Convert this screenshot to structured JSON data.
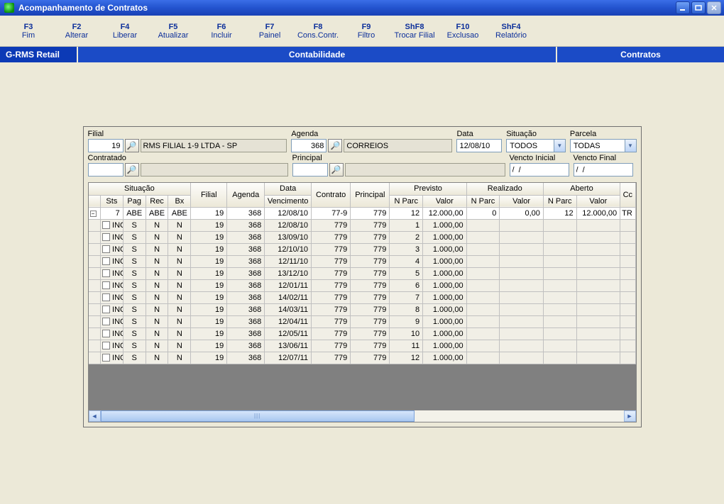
{
  "window": {
    "title": "Acompanhamento de Contratos"
  },
  "toolbar": [
    {
      "key": "F3",
      "label": "Fim"
    },
    {
      "key": "F2",
      "label": "Alterar"
    },
    {
      "key": "F4",
      "label": "Liberar"
    },
    {
      "key": "F5",
      "label": "Atualizar"
    },
    {
      "key": "F6",
      "label": "Incluir"
    },
    {
      "key": "F7",
      "label": "Painel"
    },
    {
      "key": "F8",
      "label": "Cons.Contr."
    },
    {
      "key": "F9",
      "label": "Filtro"
    },
    {
      "key": "ShF8",
      "label": "Trocar Filial"
    },
    {
      "key": "F10",
      "label": "Exclusao"
    },
    {
      "key": "ShF4",
      "label": "Relatório"
    }
  ],
  "ribbon": {
    "left": "G-RMS Retail",
    "mid": "Contabilidade",
    "right": "Contratos"
  },
  "filters": {
    "filial": {
      "label": "Filial",
      "value": "19",
      "display": "RMS FILIAL 1-9 LTDA - SP"
    },
    "agenda": {
      "label": "Agenda",
      "value": "368",
      "display": "CORREIOS"
    },
    "data": {
      "label": "Data",
      "value": "12/08/10"
    },
    "situacao": {
      "label": "Situação",
      "value": "TODOS"
    },
    "parcela": {
      "label": "Parcela",
      "value": "TODAS"
    },
    "contratado": {
      "label": "Contratado",
      "value": "",
      "display": ""
    },
    "principal": {
      "label": "Principal",
      "value": "",
      "display": ""
    },
    "vencto_ini": {
      "label": "Vencto Inicial",
      "value": "/  /"
    },
    "vencto_fim": {
      "label": "Vencto Final",
      "value": "/  /"
    }
  },
  "grid": {
    "group_headers": {
      "situacao": "Situação",
      "data": "Data",
      "previsto": "Previsto",
      "realizado": "Realizado",
      "aberto": "Aberto"
    },
    "headers": {
      "sts": "Sts",
      "pag": "Pag",
      "rec": "Rec",
      "bx": "Bx",
      "filial": "Filial",
      "agenda": "Agenda",
      "venc": "Vencimento",
      "contrato": "Contrato",
      "principal": "Principal",
      "nparc_prev": "N Parc",
      "valor_prev": "Valor",
      "nparc_real": "N Parc",
      "valor_real": "Valor",
      "nparc_abe": "N Parc",
      "valor_abe": "Valor",
      "cc": "Cc"
    },
    "summary": {
      "sts": "7",
      "pag": "ABE",
      "rec": "ABE",
      "bx": "ABE",
      "filial": "19",
      "agenda": "368",
      "venc": "12/08/10",
      "contrato": "77-9",
      "principal": "779",
      "nparc_prev": "12",
      "valor_prev": "12.000,00",
      "nparc_real": "0",
      "valor_real": "0,00",
      "nparc_abe": "12",
      "valor_abe": "12.000,00",
      "cc": "TR"
    },
    "rows": [
      {
        "sts": "INC",
        "pag": "S",
        "rec": "N",
        "bx": "N",
        "filial": "19",
        "agenda": "368",
        "venc": "12/08/10",
        "contrato": "779",
        "principal": "779",
        "nparc_prev": "1",
        "valor_prev": "1.000,00"
      },
      {
        "sts": "INC",
        "pag": "S",
        "rec": "N",
        "bx": "N",
        "filial": "19",
        "agenda": "368",
        "venc": "13/09/10",
        "contrato": "779",
        "principal": "779",
        "nparc_prev": "2",
        "valor_prev": "1.000,00"
      },
      {
        "sts": "INC",
        "pag": "S",
        "rec": "N",
        "bx": "N",
        "filial": "19",
        "agenda": "368",
        "venc": "12/10/10",
        "contrato": "779",
        "principal": "779",
        "nparc_prev": "3",
        "valor_prev": "1.000,00"
      },
      {
        "sts": "INC",
        "pag": "S",
        "rec": "N",
        "bx": "N",
        "filial": "19",
        "agenda": "368",
        "venc": "12/11/10",
        "contrato": "779",
        "principal": "779",
        "nparc_prev": "4",
        "valor_prev": "1.000,00"
      },
      {
        "sts": "INC",
        "pag": "S",
        "rec": "N",
        "bx": "N",
        "filial": "19",
        "agenda": "368",
        "venc": "13/12/10",
        "contrato": "779",
        "principal": "779",
        "nparc_prev": "5",
        "valor_prev": "1.000,00"
      },
      {
        "sts": "INC",
        "pag": "S",
        "rec": "N",
        "bx": "N",
        "filial": "19",
        "agenda": "368",
        "venc": "12/01/11",
        "contrato": "779",
        "principal": "779",
        "nparc_prev": "6",
        "valor_prev": "1.000,00"
      },
      {
        "sts": "INC",
        "pag": "S",
        "rec": "N",
        "bx": "N",
        "filial": "19",
        "agenda": "368",
        "venc": "14/02/11",
        "contrato": "779",
        "principal": "779",
        "nparc_prev": "7",
        "valor_prev": "1.000,00"
      },
      {
        "sts": "INC",
        "pag": "S",
        "rec": "N",
        "bx": "N",
        "filial": "19",
        "agenda": "368",
        "venc": "14/03/11",
        "contrato": "779",
        "principal": "779",
        "nparc_prev": "8",
        "valor_prev": "1.000,00"
      },
      {
        "sts": "INC",
        "pag": "S",
        "rec": "N",
        "bx": "N",
        "filial": "19",
        "agenda": "368",
        "venc": "12/04/11",
        "contrato": "779",
        "principal": "779",
        "nparc_prev": "9",
        "valor_prev": "1.000,00"
      },
      {
        "sts": "INC",
        "pag": "S",
        "rec": "N",
        "bx": "N",
        "filial": "19",
        "agenda": "368",
        "venc": "12/05/11",
        "contrato": "779",
        "principal": "779",
        "nparc_prev": "10",
        "valor_prev": "1.000,00"
      },
      {
        "sts": "INC",
        "pag": "S",
        "rec": "N",
        "bx": "N",
        "filial": "19",
        "agenda": "368",
        "venc": "13/06/11",
        "contrato": "779",
        "principal": "779",
        "nparc_prev": "11",
        "valor_prev": "1.000,00"
      },
      {
        "sts": "INC",
        "pag": "S",
        "rec": "N",
        "bx": "N",
        "filial": "19",
        "agenda": "368",
        "venc": "12/07/11",
        "contrato": "779",
        "principal": "779",
        "nparc_prev": "12",
        "valor_prev": "1.000,00"
      }
    ]
  }
}
